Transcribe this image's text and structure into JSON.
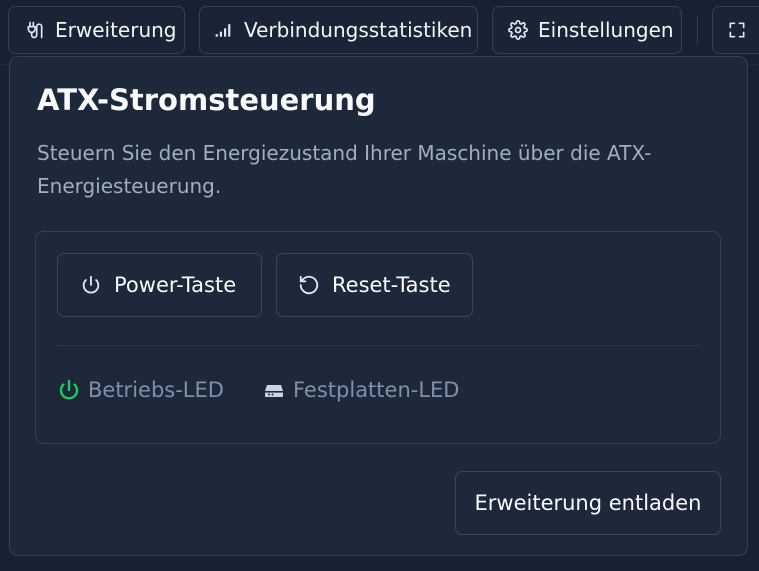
{
  "toolbar": {
    "extension_label": "Erweiterung",
    "stats_label": "Verbindungsstatistiken",
    "settings_label": "Einstellungen"
  },
  "panel": {
    "title": "ATX-Stromsteuerung",
    "description": "Steuern Sie den Energiezustand Ihrer Maschine über die ATX-Energiesteuerung.",
    "power_button_label": "Power-Taste",
    "reset_button_label": "Reset-Taste",
    "power_led_label": "Betriebs-LED",
    "hdd_led_label": "Festplatten-LED",
    "unload_button_label": "Erweiterung entladen"
  },
  "status": {
    "power_led_color": "#22c55e",
    "hdd_led_color": "#cbd5e1"
  },
  "icons": {
    "extension": "plug-icon",
    "stats": "signal-bars-icon",
    "settings": "gear-icon",
    "fullscreen": "fullscreen-icon",
    "power": "power-icon",
    "reset": "rotate-ccw-icon",
    "hdd": "hard-drive-icon"
  }
}
